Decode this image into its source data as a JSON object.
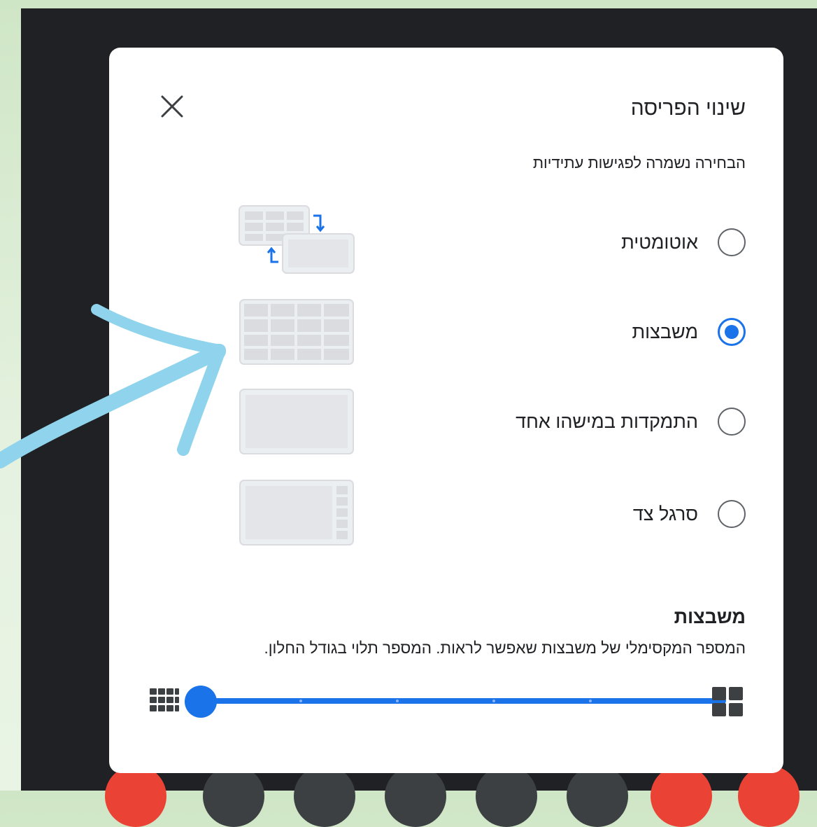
{
  "dialog": {
    "title": "שינוי הפריסה",
    "subtitle": "הבחירה נשמרה לפגישות עתידיות",
    "close_icon": "close-icon",
    "options": [
      {
        "label": "אוטומטית",
        "selected": false,
        "icon": "auto-layout-icon"
      },
      {
        "label": "משבצות",
        "selected": true,
        "icon": "tiled-layout-icon"
      },
      {
        "label": "התמקדות במישהו אחד",
        "selected": false,
        "icon": "spotlight-layout-icon"
      },
      {
        "label": "סרגל צד",
        "selected": false,
        "icon": "sidebar-layout-icon"
      }
    ],
    "tiles": {
      "title": "משבצות",
      "description": "המספר המקסימלי של משבצות שאפשר לראות. המספר תלוי בגודל החלון.",
      "slider_value": 0,
      "min_icon": "many-tiles-icon",
      "max_icon": "few-tiles-icon"
    }
  },
  "colors": {
    "accent": "#1a73e8",
    "dark_background": "#202124",
    "annotation_arrow": "#8fd4ec"
  }
}
